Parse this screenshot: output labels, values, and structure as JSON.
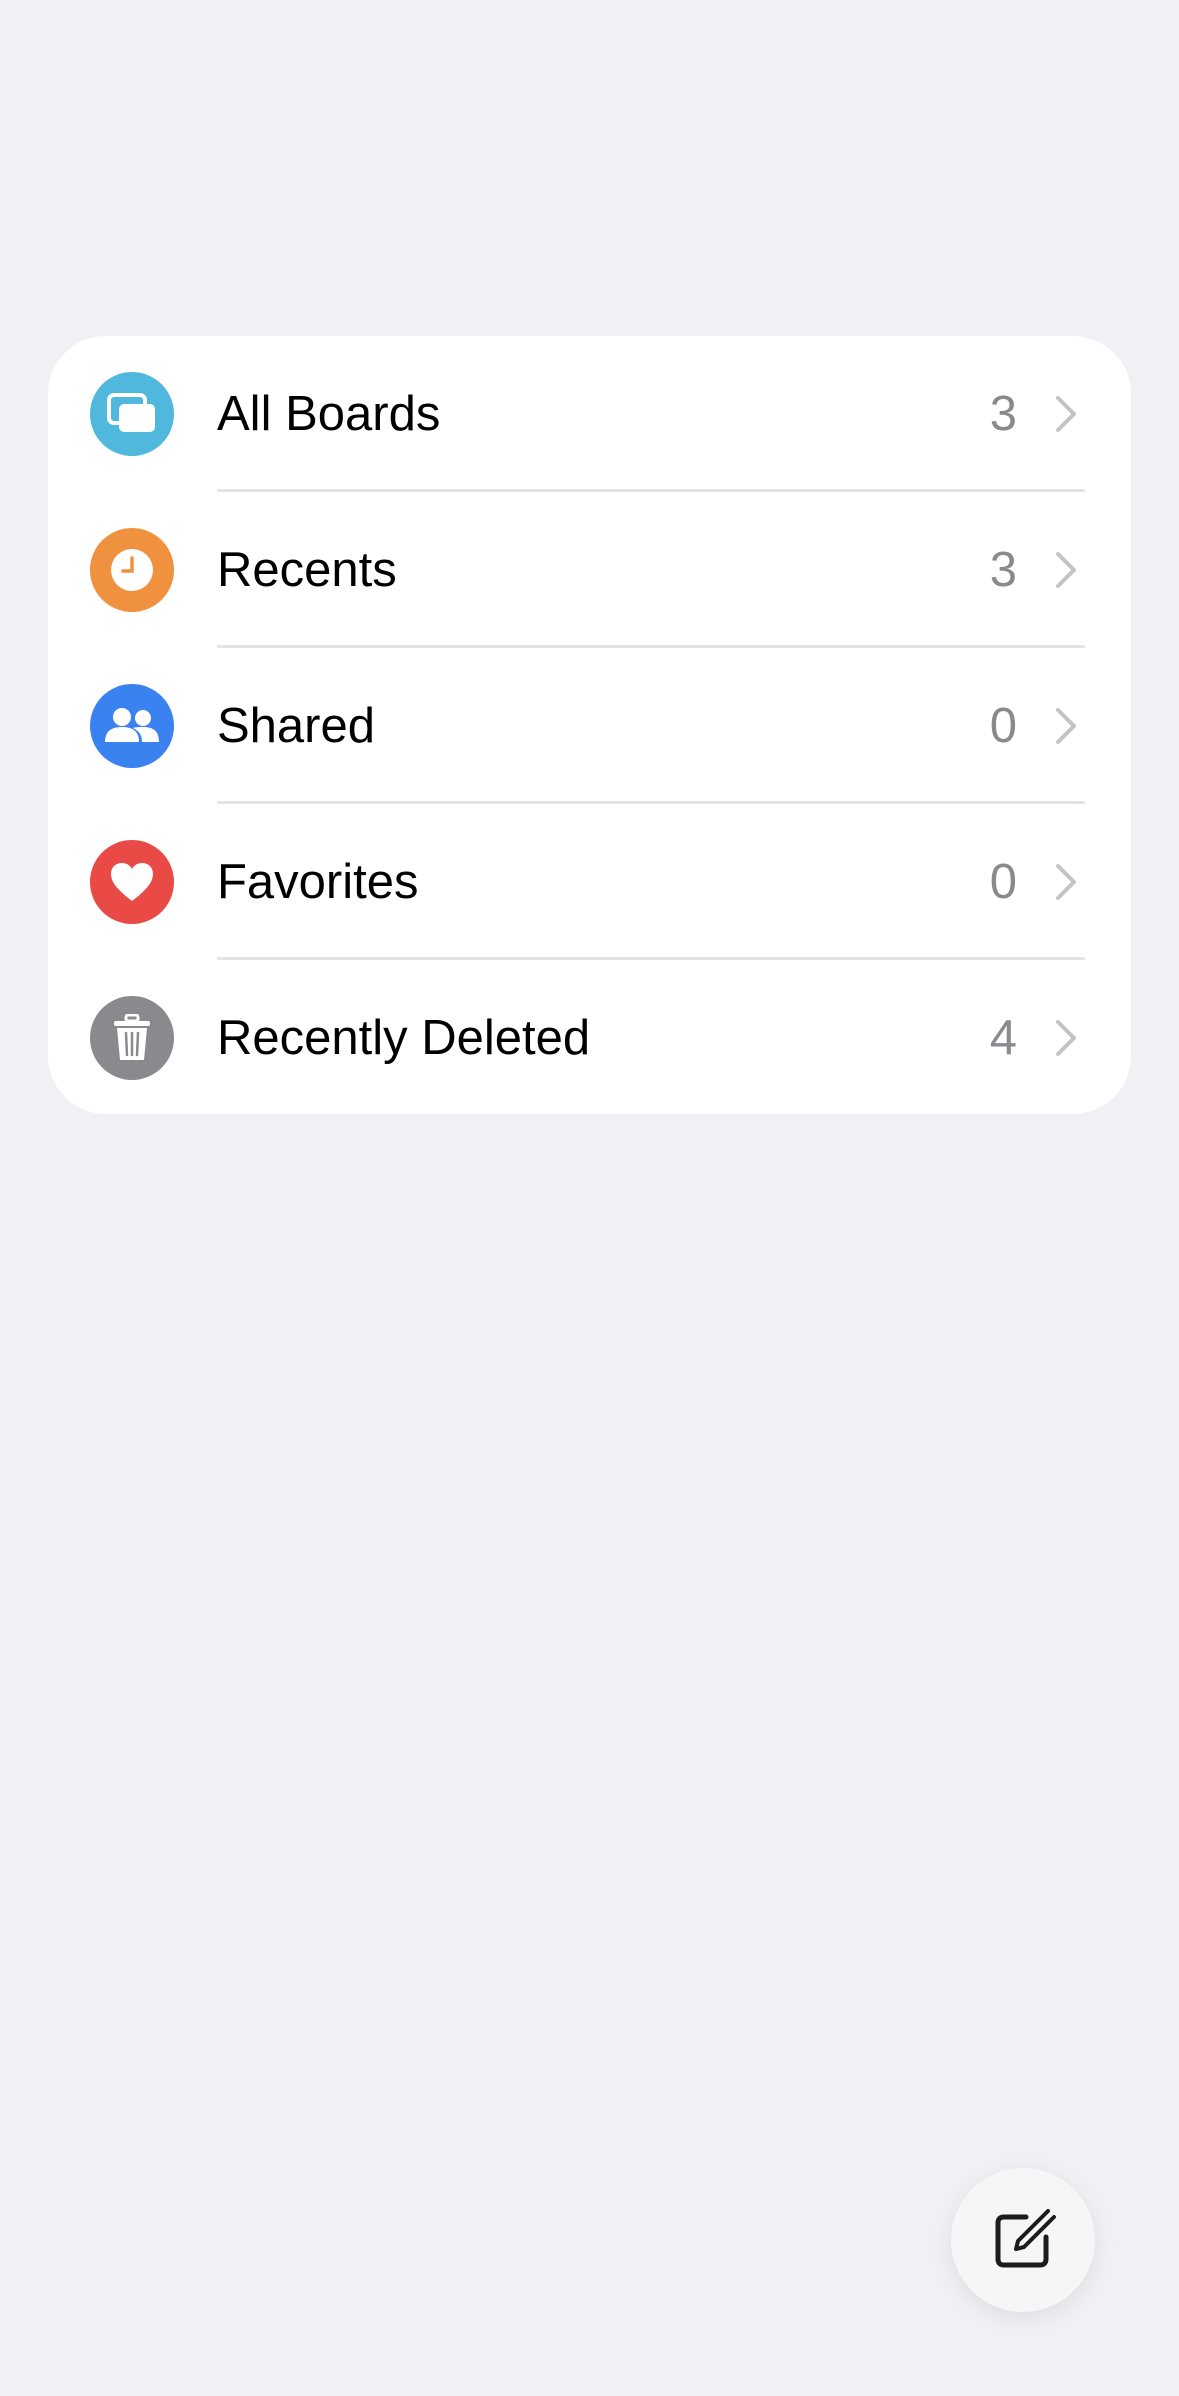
{
  "colors": {
    "background": "#f0f0f5",
    "card": "#ffffff",
    "all_boards_icon": "#4fb8dc",
    "recents_icon": "#f0913f",
    "shared_icon": "#3b82f1",
    "favorites_icon": "#e94a45",
    "recently_deleted_icon": "#8a8a8e",
    "count_text": "#8a8a8e",
    "chevron": "#c4c4c7"
  },
  "list": {
    "items": [
      {
        "label": "All Boards",
        "count": "3",
        "icon": "boards-icon"
      },
      {
        "label": "Recents",
        "count": "3",
        "icon": "clock-icon"
      },
      {
        "label": "Shared",
        "count": "0",
        "icon": "people-icon"
      },
      {
        "label": "Favorites",
        "count": "0",
        "icon": "heart-icon"
      },
      {
        "label": "Recently Deleted",
        "count": "4",
        "icon": "trash-icon"
      }
    ]
  },
  "fab": {
    "icon": "compose-icon"
  }
}
